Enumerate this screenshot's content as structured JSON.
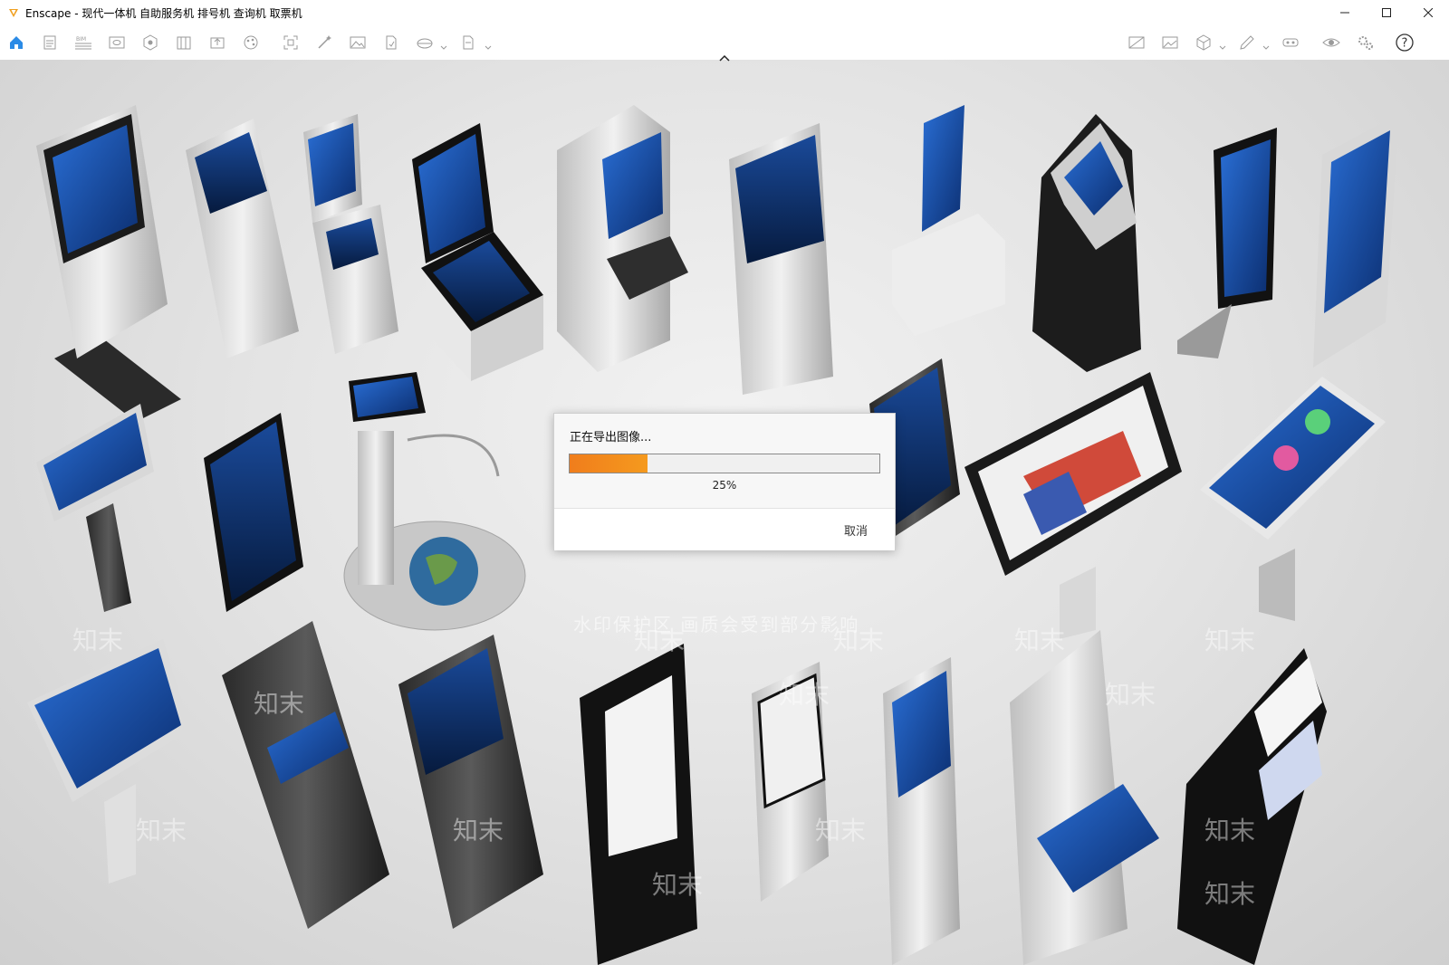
{
  "window": {
    "title": "Enscape - 现代一体机 自助服务机 排号机 查询机 取票机",
    "accent": "#f0a020"
  },
  "toolbar": {
    "left_icons": [
      "home-icon",
      "document-icon",
      "bim-icon",
      "view-icon",
      "asset-icon",
      "library-icon",
      "upload-icon",
      "palette-icon",
      "capture-icon",
      "magic-icon",
      "image-icon",
      "document-export-icon",
      "panorama-icon",
      "batch-render-icon"
    ],
    "right_icons": [
      "image-compare-icon",
      "gallery-icon",
      "cube-icon",
      "sketch-icon",
      "vr-headset-icon",
      "eye-icon",
      "settings-icon",
      "help-icon"
    ]
  },
  "viewport": {
    "watermark": "水印保护区   画质会受到部分影响",
    "watermark_logo": "知末"
  },
  "dialog": {
    "title": "正在导出图像...",
    "progress_percent": 25,
    "progress_label": "25%",
    "cancel_label": "取消",
    "progress_color": "#f07d1c"
  }
}
